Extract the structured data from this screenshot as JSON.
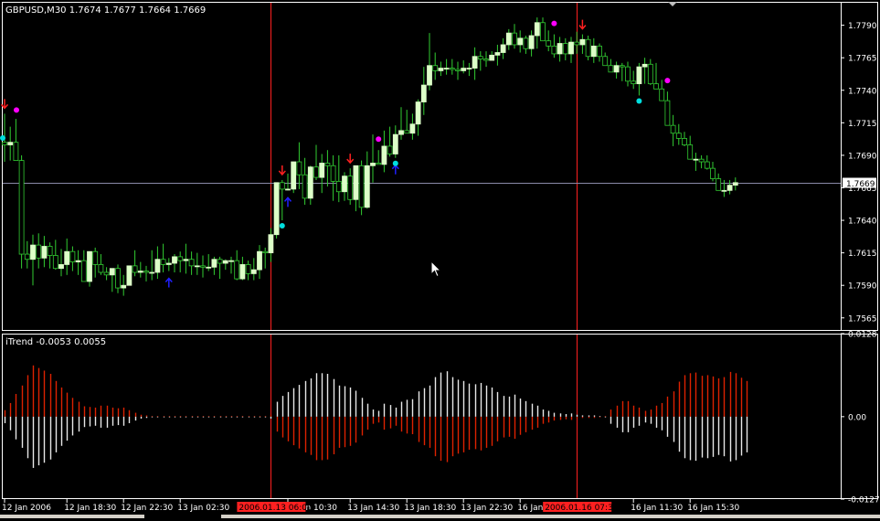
{
  "window": {
    "title": "GBPUSD,M30  1.7674 1.7677 1.7664 1.7669",
    "symbol": "GBPUSD",
    "timeframe": "M30"
  },
  "chart_data": [
    {
      "type": "candlestick",
      "title": "GBPUSD,M30",
      "ohlc_display": "1.7674 1.7677 1.7664 1.7669",
      "last_price": 1.7669,
      "current_price_label": "1.7669",
      "ylim": [
        1.7555,
        1.7808
      ],
      "yticks": [
        "1.7790",
        "1.7765",
        "1.7740",
        "1.7715",
        "1.7690",
        "1.7665",
        "1.7640",
        "1.7615",
        "1.7590",
        "1.7565"
      ],
      "series": [
        {
          "name": "candles",
          "open": [
            1.77,
            1.7698,
            1.77,
            1.7686,
            1.7614,
            1.761,
            1.7621,
            1.7611,
            1.762,
            1.7613,
            1.7603,
            1.7606,
            1.7616,
            1.7608,
            1.7609,
            1.7593,
            1.7616,
            1.7606,
            1.76,
            1.7598,
            1.7603,
            1.7588,
            1.759,
            1.7605,
            1.76,
            1.7601,
            1.76,
            1.76,
            1.761,
            1.7606,
            1.7607,
            1.7612,
            1.7609,
            1.761,
            1.7605,
            1.7605,
            1.7604,
            1.7604,
            1.761,
            1.7607,
            1.7609,
            1.7609,
            1.7595,
            1.7606,
            1.7599,
            1.7602,
            1.7616,
            1.7615,
            1.7629,
            1.7669,
            1.7664,
            1.7664,
            1.7685,
            1.7675,
            1.7657,
            1.7681,
            1.7673,
            1.7684,
            1.7682,
            1.767,
            1.7662,
            1.7674,
            1.7656,
            1.7682,
            1.765,
            1.7682,
            1.7684,
            1.7683,
            1.7697,
            1.7691,
            1.7706,
            1.7709,
            1.7707,
            1.7714,
            1.7731,
            1.7744,
            1.7759,
            1.7755,
            1.7757,
            1.7757,
            1.7756,
            1.7755,
            1.7757,
            1.7757,
            1.7766,
            1.7764,
            1.7763,
            1.7767,
            1.7769,
            1.7775,
            1.7784,
            1.7775,
            1.778,
            1.7772,
            1.7782,
            1.7792,
            1.7778,
            1.7774,
            1.7768,
            1.7776,
            1.7768,
            1.7777,
            1.7775,
            1.7779,
            1.7766,
            1.7774,
            1.7766,
            1.7759,
            1.7754,
            1.7759,
            1.7758,
            1.7747,
            1.7745,
            1.7758,
            1.776,
            1.7745,
            1.7741,
            1.7732,
            1.7713,
            1.7707,
            1.7703,
            1.7698,
            1.7687,
            1.7687,
            1.7685,
            1.768,
            1.7672,
            1.7663,
            1.7663,
            1.7667
          ],
          "high": [
            1.7722,
            1.7712,
            1.7718,
            1.769,
            1.7624,
            1.7629,
            1.763,
            1.7628,
            1.7623,
            1.7625,
            1.7618,
            1.7626,
            1.762,
            1.7617,
            1.7617,
            1.7614,
            1.7619,
            1.7614,
            1.7604,
            1.7603,
            1.7606,
            1.7598,
            1.7602,
            1.7617,
            1.7608,
            1.7605,
            1.7617,
            1.762,
            1.7622,
            1.7611,
            1.7614,
            1.7616,
            1.7622,
            1.7616,
            1.7615,
            1.7613,
            1.7614,
            1.7612,
            1.7612,
            1.761,
            1.7612,
            1.7617,
            1.7612,
            1.7609,
            1.7611,
            1.7621,
            1.7619,
            1.7634,
            1.7669,
            1.7671,
            1.7676,
            1.7685,
            1.77,
            1.7688,
            1.7682,
            1.7698,
            1.7691,
            1.7694,
            1.769,
            1.769,
            1.7677,
            1.768,
            1.7682,
            1.7686,
            1.7693,
            1.7706,
            1.7694,
            1.7709,
            1.7712,
            1.7713,
            1.7727,
            1.7725,
            1.7722,
            1.7733,
            1.7758,
            1.7784,
            1.7769,
            1.7762,
            1.7764,
            1.7764,
            1.7762,
            1.7763,
            1.7761,
            1.7773,
            1.777,
            1.777,
            1.777,
            1.7775,
            1.778,
            1.7787,
            1.7791,
            1.7786,
            1.7782,
            1.7786,
            1.7796,
            1.7796,
            1.7786,
            1.7783,
            1.7781,
            1.778,
            1.7781,
            1.7785,
            1.7783,
            1.7782,
            1.778,
            1.7776,
            1.7769,
            1.7764,
            1.7762,
            1.7761,
            1.7762,
            1.7755,
            1.7761,
            1.7765,
            1.7764,
            1.7761,
            1.7748,
            1.7739,
            1.7721,
            1.7714,
            1.7708,
            1.7705,
            1.7692,
            1.769,
            1.769,
            1.7685,
            1.7676,
            1.7671,
            1.7671,
            1.7673
          ],
          "low": [
            1.7685,
            1.7686,
            1.7687,
            1.7603,
            1.7603,
            1.759,
            1.7603,
            1.7604,
            1.7603,
            1.7602,
            1.7597,
            1.7598,
            1.7601,
            1.7598,
            1.7598,
            1.7589,
            1.7596,
            1.7598,
            1.7594,
            1.7585,
            1.7584,
            1.7582,
            1.759,
            1.7597,
            1.7596,
            1.7593,
            1.7594,
            1.7595,
            1.76,
            1.7601,
            1.76,
            1.76,
            1.7599,
            1.7598,
            1.7598,
            1.7596,
            1.7601,
            1.7598,
            1.7595,
            1.7602,
            1.7599,
            1.7594,
            1.7594,
            1.7594,
            1.7594,
            1.7595,
            1.7603,
            1.7608,
            1.7626,
            1.764,
            1.7663,
            1.7661,
            1.7664,
            1.7652,
            1.7652,
            1.7671,
            1.7661,
            1.7666,
            1.7655,
            1.7654,
            1.7655,
            1.7652,
            1.7647,
            1.7644,
            1.7649,
            1.7669,
            1.7684,
            1.7677,
            1.7689,
            1.7688,
            1.7702,
            1.7707,
            1.7702,
            1.7705,
            1.7721,
            1.774,
            1.7748,
            1.7751,
            1.7752,
            1.7752,
            1.7748,
            1.7753,
            1.7751,
            1.7748,
            1.7755,
            1.7758,
            1.7763,
            1.7759,
            1.7764,
            1.7771,
            1.7772,
            1.7769,
            1.7768,
            1.7766,
            1.7772,
            1.7778,
            1.777,
            1.7765,
            1.7762,
            1.7763,
            1.7761,
            1.7768,
            1.7768,
            1.7763,
            1.7761,
            1.7762,
            1.7761,
            1.7755,
            1.7749,
            1.7747,
            1.7743,
            1.7741,
            1.7736,
            1.7745,
            1.7744,
            1.7744,
            1.7735,
            1.7727,
            1.7697,
            1.7698,
            1.7697,
            1.7689,
            1.7678,
            1.768,
            1.7679,
            1.767,
            1.7666,
            1.7658,
            1.766,
            1.7663
          ],
          "close": [
            1.7698,
            1.77,
            1.7686,
            1.7614,
            1.761,
            1.7621,
            1.7611,
            1.762,
            1.7613,
            1.7603,
            1.7606,
            1.7616,
            1.7608,
            1.7609,
            1.7593,
            1.7616,
            1.7606,
            1.76,
            1.7598,
            1.7603,
            1.7588,
            1.759,
            1.7605,
            1.76,
            1.7601,
            1.76,
            1.76,
            1.761,
            1.7606,
            1.7607,
            1.7612,
            1.7609,
            1.761,
            1.7605,
            1.7605,
            1.7604,
            1.7604,
            1.761,
            1.7607,
            1.7609,
            1.7609,
            1.7595,
            1.7606,
            1.7599,
            1.7602,
            1.7616,
            1.7615,
            1.7629,
            1.7669,
            1.7664,
            1.7664,
            1.7685,
            1.7675,
            1.7657,
            1.7681,
            1.7673,
            1.7684,
            1.7682,
            1.767,
            1.7662,
            1.7674,
            1.7656,
            1.7682,
            1.765,
            1.7682,
            1.7684,
            1.7683,
            1.7697,
            1.7691,
            1.7706,
            1.7709,
            1.7707,
            1.7714,
            1.7731,
            1.7744,
            1.7759,
            1.7755,
            1.7757,
            1.7757,
            1.7756,
            1.7755,
            1.7757,
            1.7757,
            1.7766,
            1.7764,
            1.7763,
            1.7767,
            1.7769,
            1.7775,
            1.7784,
            1.7775,
            1.778,
            1.7772,
            1.7782,
            1.7792,
            1.7778,
            1.7774,
            1.7768,
            1.7776,
            1.7768,
            1.7777,
            1.7775,
            1.7779,
            1.7766,
            1.7774,
            1.7766,
            1.7759,
            1.7754,
            1.7759,
            1.7758,
            1.7747,
            1.7745,
            1.7758,
            1.776,
            1.7745,
            1.7741,
            1.7732,
            1.7713,
            1.7707,
            1.7703,
            1.7698,
            1.7687,
            1.7687,
            1.7685,
            1.768,
            1.7672,
            1.7663,
            1.7663,
            1.7667,
            1.7669
          ]
        }
      ],
      "arrows_down": [
        0,
        49,
        61,
        102
      ],
      "arrows_up": [
        29,
        50,
        69
      ],
      "magenta_dots": [
        0,
        66,
        97,
        117
      ],
      "cyan_dots": [
        0,
        49,
        69,
        112
      ]
    },
    {
      "type": "histogram",
      "title": "iTrend",
      "label": "iTrend -0.0053 0.0055",
      "ylim": [
        -0.0127,
        0.0128
      ],
      "yticks": [
        "0.0128",
        "0.00",
        "-0.0127"
      ],
      "series": [
        {
          "name": "red",
          "values": [
            0.001,
            0.0021,
            0.0035,
            0.0048,
            0.0064,
            0.0079,
            0.0075,
            0.0071,
            0.0066,
            0.0055,
            0.0045,
            0.0037,
            0.0029,
            0.0023,
            0.0016,
            0.0015,
            0.0014,
            0.0017,
            0.0017,
            0.0014,
            0.0013,
            0.0014,
            0.001,
            0.0006,
            0.0003,
            0.0002,
            0.0001,
            0.0001,
            0.0001,
            0.0001,
            0.0001,
            0.0001,
            0.0001,
            0.0001,
            0.0001,
            0.0001,
            0.0001,
            0.0001,
            0.0001,
            0.0001,
            0.0001,
            0.0001,
            0.0001,
            0.0001,
            0.0001,
            0.0001,
            0.0001,
            0.0003,
            -0.0023,
            -0.0032,
            -0.0038,
            -0.0044,
            -0.0049,
            -0.0055,
            -0.0059,
            -0.0067,
            -0.0067,
            -0.0066,
            -0.0058,
            -0.0048,
            -0.0047,
            -0.0045,
            -0.004,
            -0.0029,
            -0.002,
            -0.0011,
            -0.0009,
            -0.002,
            -0.0018,
            -0.0014,
            -0.0023,
            -0.0026,
            -0.0027,
            -0.0039,
            -0.0044,
            -0.0048,
            -0.0061,
            -0.0068,
            -0.007,
            -0.0061,
            -0.0057,
            -0.0055,
            -0.0051,
            -0.005,
            -0.0052,
            -0.0048,
            -0.0045,
            -0.0038,
            -0.0032,
            -0.0031,
            -0.0034,
            -0.0028,
            -0.0024,
            -0.002,
            -0.0017,
            -0.0011,
            -0.0009,
            -0.0006,
            -0.0005,
            -0.0004,
            -0.0005,
            -0.0003,
            -0.0002,
            -0.0002,
            -0.0002,
            -0.0001,
            0.0001,
            0.0011,
            0.0017,
            0.0024,
            0.0024,
            0.0017,
            0.0014,
            0.0009,
            0.0011,
            0.0017,
            0.0021,
            0.0031,
            0.0039,
            0.0054,
            0.0064,
            0.0067,
            0.0068,
            0.0063,
            0.0064,
            0.0062,
            0.0059,
            0.0061,
            0.0069,
            0.0067,
            0.006,
            0.0055
          ]
        },
        {
          "name": "white",
          "values": [
            -0.001,
            -0.0021,
            -0.0035,
            -0.0048,
            -0.0064,
            -0.0079,
            -0.0075,
            -0.0071,
            -0.0066,
            -0.0055,
            -0.0045,
            -0.0037,
            -0.0029,
            -0.0023,
            -0.0016,
            -0.0015,
            -0.0014,
            -0.0017,
            -0.0017,
            -0.0014,
            -0.0013,
            -0.0014,
            -0.001,
            -0.0006,
            -0.0003,
            -0.0002,
            -0.0001,
            -0.0001,
            -0.0001,
            -0.0001,
            -0.0001,
            -0.0001,
            -0.0001,
            -0.0001,
            -0.0001,
            -0.0001,
            -0.0001,
            -0.0001,
            -0.0001,
            -0.0001,
            -0.0001,
            -0.0001,
            -0.0001,
            -0.0001,
            -0.0001,
            -0.0001,
            -0.0001,
            -0.0003,
            0.0023,
            0.0032,
            0.0038,
            0.0044,
            0.0049,
            0.0055,
            0.0059,
            0.0067,
            0.0067,
            0.0066,
            0.0058,
            0.0048,
            0.0047,
            0.0045,
            0.004,
            0.0029,
            0.002,
            0.0011,
            0.0009,
            0.002,
            0.0018,
            0.0014,
            0.0023,
            0.0026,
            0.0027,
            0.0039,
            0.0044,
            0.0048,
            0.0061,
            0.0068,
            0.007,
            0.0061,
            0.0057,
            0.0055,
            0.0051,
            0.005,
            0.0052,
            0.0048,
            0.0045,
            0.0038,
            0.0032,
            0.0031,
            0.0034,
            0.0028,
            0.0024,
            0.002,
            0.0017,
            0.0011,
            0.0009,
            0.0006,
            0.0005,
            0.0004,
            0.0005,
            0.0003,
            0.0002,
            0.0002,
            0.0002,
            0.0001,
            -0.0001,
            -0.0011,
            -0.0017,
            -0.0024,
            -0.0024,
            -0.0017,
            -0.0014,
            -0.0009,
            -0.0011,
            -0.0017,
            -0.0021,
            -0.0031,
            -0.0039,
            -0.0054,
            -0.0064,
            -0.0067,
            -0.0068,
            -0.0063,
            -0.0064,
            -0.0062,
            -0.0059,
            -0.0061,
            -0.0069,
            -0.0067,
            -0.006,
            -0.0055
          ]
        }
      ]
    }
  ],
  "time_axis": {
    "labels": [
      "12 Jan 2006",
      "12 Jan 18:30",
      "12 Jan 22:30",
      "13 Jan 02:30",
      "13 Jan 10:30",
      "13 Jan 14:30",
      "13 Jan 18:30",
      "13 Jan 22:30",
      "16 Jan",
      "16 Jan 11:30",
      "16 Jan 15:30"
    ],
    "label_bars": [
      0,
      11,
      21,
      31,
      50,
      61,
      71,
      81,
      91,
      111,
      121
    ],
    "markers": [
      {
        "label": "2006.01.13 06:00",
        "bar": 47
      },
      {
        "label": "2006.01.16 07:30",
        "bar": 101
      }
    ]
  },
  "colors": {
    "background": "#000000",
    "frame": "#ffffff",
    "bull_candle": "#ddffc8",
    "wick": "#32cd32",
    "bear_candle": "#000000",
    "vline": "#ff2020",
    "hline": "#8a8aa8",
    "arrow_down": "#ff2020",
    "arrow_up": "#2020ff",
    "dot_magenta": "#ff00ff",
    "dot_cyan": "#00dede",
    "hist_red": "#dd2200",
    "hist_white": "#e8e8e8",
    "marker_bg": "#ff2020"
  }
}
